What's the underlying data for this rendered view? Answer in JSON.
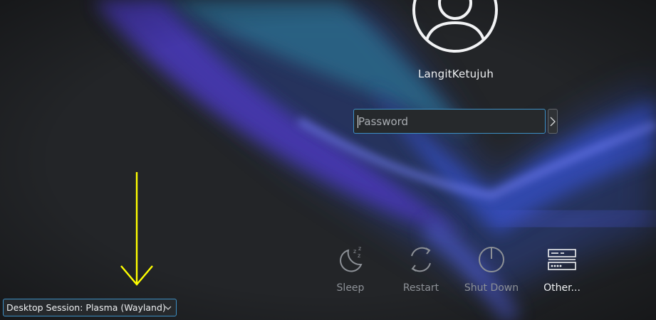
{
  "user": {
    "name": "LangitKetujuh",
    "avatar_icon": "user-avatar-icon"
  },
  "password": {
    "placeholder": "Password",
    "value": "",
    "login_icon": "chevron-right-icon"
  },
  "actions": [
    {
      "label": "Sleep",
      "icon": "sleep-icon"
    },
    {
      "label": "Restart",
      "icon": "restart-icon"
    },
    {
      "label": "Shut Down",
      "icon": "power-icon"
    },
    {
      "label": "Other...",
      "icon": "other-users-icon"
    }
  ],
  "session": {
    "label": "Desktop Session: Plasma (Wayland)",
    "icon": "chevron-down-icon"
  },
  "annotation": {
    "arrow_color": "#ffff00"
  },
  "colors": {
    "background": "#232528",
    "accent": "#3d8fc4",
    "text": "#eef0f2",
    "dim_text": "#8c9096"
  }
}
